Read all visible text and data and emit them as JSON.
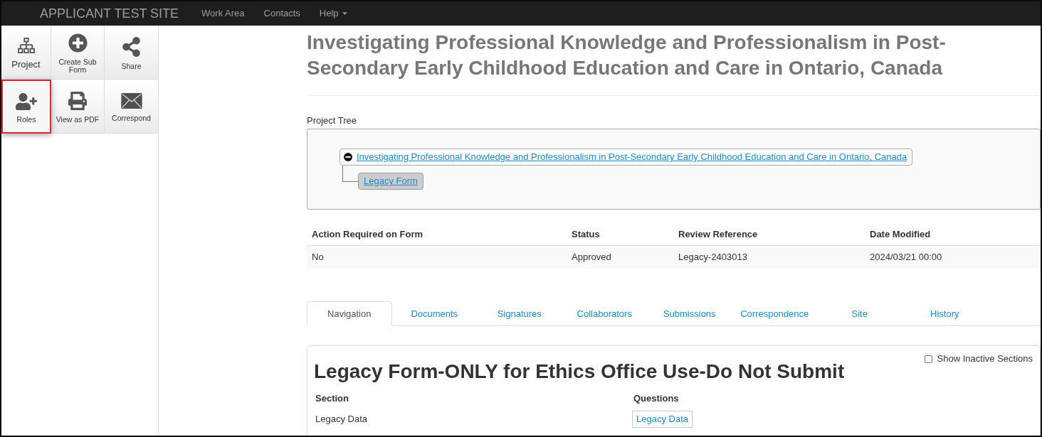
{
  "navbar": {
    "brand": "APPLICANT TEST SITE",
    "links": [
      {
        "label": "Work Area",
        "kind": "link"
      },
      {
        "label": "Contacts",
        "kind": "link"
      },
      {
        "label": "Help",
        "kind": "dropdown"
      }
    ]
  },
  "sidebar": {
    "tiles": [
      {
        "label": "Project",
        "selected": false
      },
      {
        "label": "Create Sub Form",
        "selected": false
      },
      {
        "label": "Share",
        "selected": false
      },
      {
        "label": "Roles",
        "selected": true
      },
      {
        "label": "View as PDF",
        "selected": false
      },
      {
        "label": "Correspond",
        "selected": false
      }
    ]
  },
  "page_title": "Investigating Professional Knowledge and Professionalism in Post-Secondary Early Childhood Education and Care in Ontario, Canada",
  "project_tree": {
    "label": "Project Tree",
    "nodes": [
      {
        "label": "Investigating Professional Knowledge and Professionalism in Post-Secondary Early Childhood Education and Care in Ontario, Canada",
        "expanded": true,
        "selected": false,
        "children": [
          {
            "label": "Legacy Form",
            "selected": true
          }
        ]
      }
    ]
  },
  "form_table": {
    "columns": [
      "Action Required on Form",
      "Status",
      "Review Reference",
      "Date Modified"
    ],
    "rows": [
      [
        "No",
        "Approved",
        "Legacy-2403013",
        "2024/03/21 00:00"
      ]
    ]
  },
  "tabs": [
    {
      "label": "Navigation",
      "selected": true
    },
    {
      "label": "Documents",
      "selected": false
    },
    {
      "label": "Signatures",
      "selected": false
    },
    {
      "label": "Collaborators",
      "selected": false
    },
    {
      "label": "Submissions",
      "selected": false
    },
    {
      "label": "Correspondence",
      "selected": false
    },
    {
      "label": "Site",
      "selected": false
    },
    {
      "label": "History",
      "selected": false
    }
  ],
  "form_panel": {
    "show_inactive": {
      "label": "Show Inactive Sections",
      "checked": false
    },
    "title": "Legacy Form-ONLY for Ethics Office Use-Do Not Submit",
    "columns": [
      "Section",
      "Questions"
    ],
    "rows": [
      {
        "section": "Legacy Data",
        "question": "Legacy Data"
      }
    ]
  }
}
